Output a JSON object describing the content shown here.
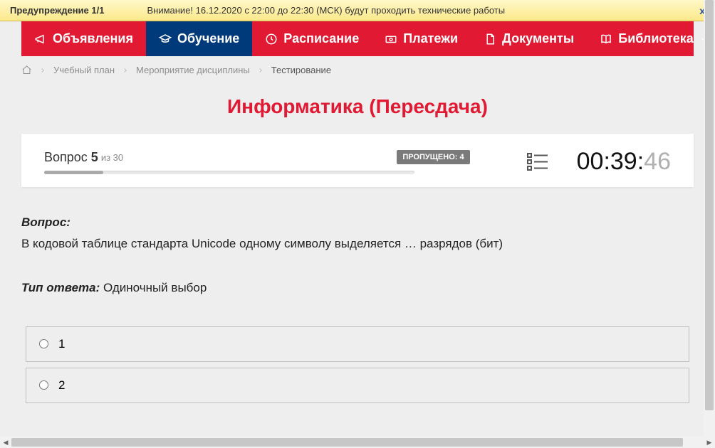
{
  "warning": {
    "label": "Предупреждение 1/1",
    "text": "Внимание! 16.12.2020 с 22:00 до 22:30 (МСК) будут проходить технические работы",
    "close": "x"
  },
  "nav": {
    "items": [
      {
        "label": "Объявления",
        "icon": "megaphone-icon"
      },
      {
        "label": "Обучение",
        "icon": "education-icon",
        "active": true
      },
      {
        "label": "Расписание",
        "icon": "clock-icon"
      },
      {
        "label": "Платежи",
        "icon": "money-icon"
      },
      {
        "label": "Документы",
        "icon": "document-icon"
      },
      {
        "label": "Библиотека",
        "icon": "book-icon",
        "caret": true
      }
    ]
  },
  "breadcrumb": {
    "items": [
      {
        "label": "Учебный план"
      },
      {
        "label": "Мероприятие дисциплины"
      }
    ],
    "current": "Тестирование"
  },
  "page_title": "Информатика (Пересдача)",
  "question_bar": {
    "label_prefix": "Вопрос ",
    "number": "5",
    "of_prefix": "из ",
    "total": "30",
    "skipped_label": "ПРОПУЩЕНО: ",
    "skipped_count": "4",
    "progress_percent": 16
  },
  "timer": {
    "mm": "00",
    "ss": "39",
    "ms": "46"
  },
  "question": {
    "title": "Вопрос:",
    "text": "В кодовой таблице стандарта Unicode одному символу выделяется … разрядов (бит)",
    "answer_type_label": "Тип ответа:",
    "answer_type_value": " Одиночный выбор"
  },
  "options": [
    {
      "label": "1"
    },
    {
      "label": "2"
    }
  ]
}
